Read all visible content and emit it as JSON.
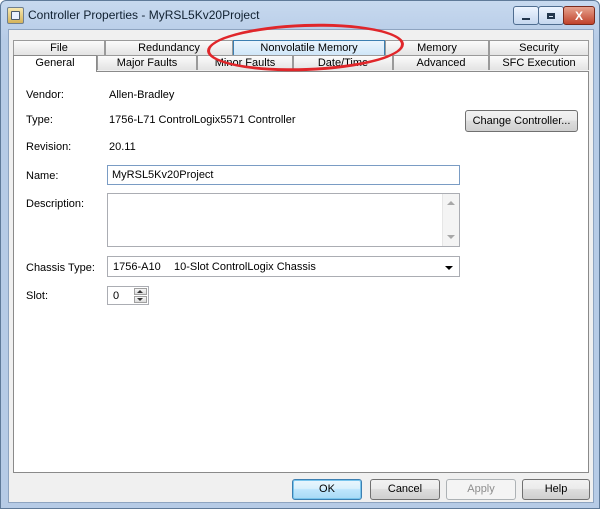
{
  "window": {
    "title": "Controller Properties - MyRSL5Kv20Project",
    "minimize_label": "_",
    "maximize_label": "□",
    "close_label": "X"
  },
  "tabs": {
    "row1": [
      "File",
      "Redundancy",
      "Nonvolatile Memory",
      "Memory",
      "Security"
    ],
    "row2": [
      "General",
      "Major Faults",
      "Minor Faults",
      "Date/Time",
      "Advanced",
      "SFC Execution"
    ],
    "active": "General",
    "highlighted": "Nonvolatile Memory"
  },
  "general": {
    "vendor_label": "Vendor:",
    "vendor_value": "Allen-Bradley",
    "type_label": "Type:",
    "type_value": "1756-L71 ControlLogix5571 Controller",
    "change_controller_label": "Change Controller...",
    "revision_label": "Revision:",
    "revision_value": "20.11",
    "name_label": "Name:",
    "name_value": "MyRSL5Kv20Project",
    "description_label": "Description:",
    "description_value": "",
    "chassis_type_label": "Chassis Type:",
    "chassis_type_code": "1756-A10",
    "chassis_type_desc": "10-Slot ControlLogix Chassis",
    "slot_label": "Slot:",
    "slot_value": "0"
  },
  "buttons": {
    "ok": "OK",
    "cancel": "Cancel",
    "apply": "Apply",
    "help": "Help"
  },
  "colors": {
    "annotation_ellipse": "#e0262a",
    "title_bar": "#b6cbe6",
    "tab_hover": "#cfe6f8"
  }
}
